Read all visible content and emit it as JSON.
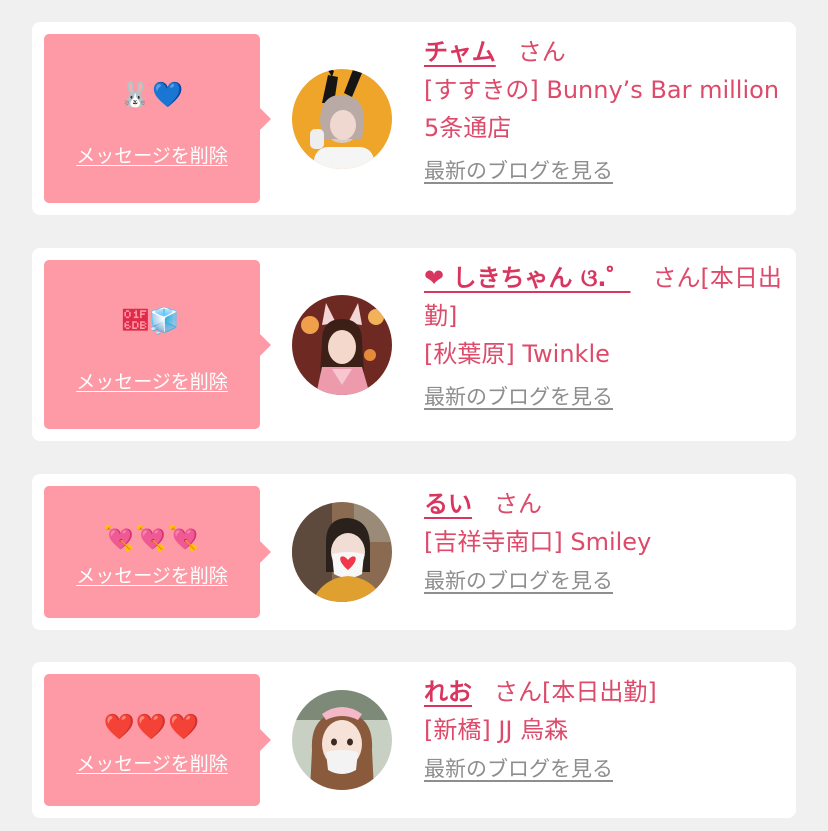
{
  "cards": [
    {
      "name": "チャム",
      "suffix": "さん",
      "shop": "[すすきの] Bunny’s Bar million 5条通店",
      "message_emoji": "🐰💙",
      "delete_label": "メッセージを削除",
      "blog_label": "最新のブログを見る"
    },
    {
      "name": "❤︎ しきちゃん ଓ.゜",
      "suffix": "さん[本日出勤]",
      "shop": "[秋葉原] Twinkle",
      "message_emoji": "🛛🧊",
      "delete_label": "メッセージを削除",
      "blog_label": "最新のブログを見る"
    },
    {
      "name": "るい",
      "suffix": "さん",
      "shop": "[吉祥寺南口] Smiley",
      "message_emoji": "💘💘💘",
      "delete_label": "メッセージを削除",
      "blog_label": "最新のブログを見る"
    },
    {
      "name": "れお",
      "suffix": "さん[本日出勤]",
      "shop": "[新橋] JJ 烏森",
      "message_emoji": "❤️❤️❤️",
      "delete_label": "メッセージを削除",
      "blog_label": "最新のブログを見る"
    }
  ],
  "colors": {
    "bubble": "#fd9aa6",
    "name": "#d8365f",
    "text": "#dd4a6a",
    "link_gray": "#8e8e8e",
    "background": "#f0f0f0"
  }
}
